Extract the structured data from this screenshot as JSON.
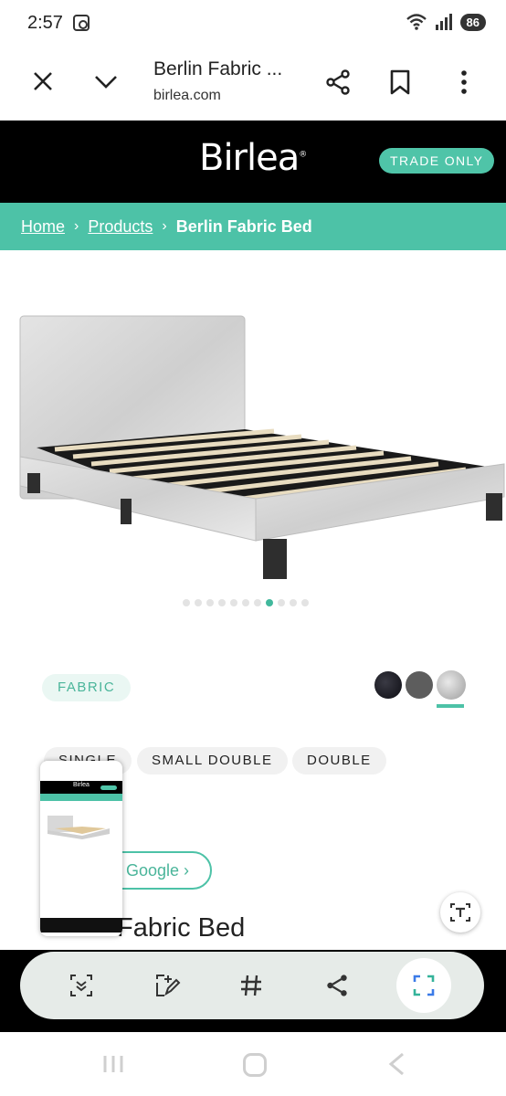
{
  "status_bar": {
    "time": "2:57",
    "battery": "86"
  },
  "browser": {
    "title": "Berlin Fabric ...",
    "url": "birlea.com"
  },
  "site": {
    "logo": "Birlea",
    "trade_label": "TRADE ONLY"
  },
  "breadcrumb": {
    "home": "Home",
    "products": "Products",
    "current": "Berlin Fabric Bed"
  },
  "gallery": {
    "dot_count": 11,
    "active_index": 7
  },
  "product": {
    "material": "FABRIC",
    "swatches": [
      "black",
      "grey",
      "silver"
    ],
    "selected_swatch": "silver",
    "sizes": [
      "SINGLE",
      "SMALL DOUBLE",
      "DOUBLE"
    ],
    "google_label": "Google",
    "title_visible": "Fabric Bed"
  },
  "capture_toolbar": {
    "tools": [
      "scroll-capture",
      "draw",
      "tag",
      "share",
      "crop"
    ]
  },
  "colors": {
    "accent": "#4dc2a7",
    "header_bg": "#000000"
  }
}
